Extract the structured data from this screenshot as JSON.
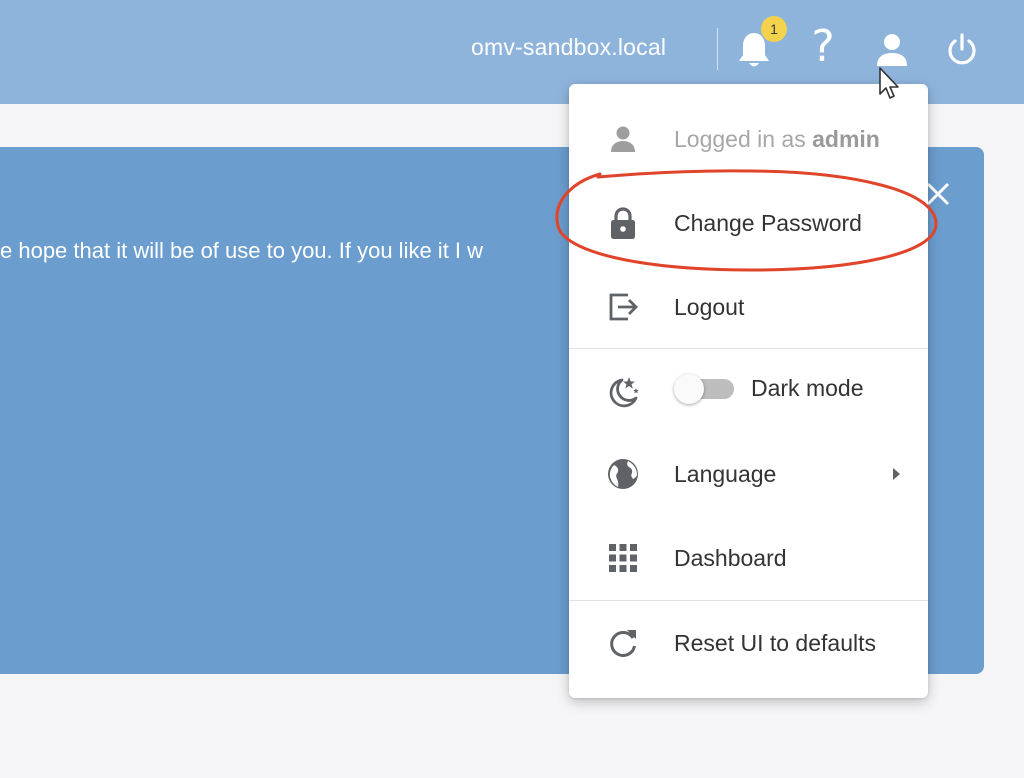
{
  "header": {
    "hostname": "omv-sandbox.local",
    "notifications_count": "1",
    "help_glyph": "?",
    "icons": [
      "bell-icon",
      "help-icon",
      "user-icon",
      "power-icon"
    ]
  },
  "welcome": {
    "text": "e hope that it will be of use to you. If you like it I w",
    "close_icon": "close-icon"
  },
  "user_menu": {
    "logged_in_prefix": "Logged in as ",
    "username": "admin",
    "items": [
      {
        "label": "Change Password",
        "icon": "lock-icon"
      },
      {
        "label": "Logout",
        "icon": "logout-icon"
      },
      {
        "label": "Dark mode",
        "icon": "moon-stars-icon",
        "toggle_on": false
      },
      {
        "label": "Language",
        "icon": "globe-icon"
      },
      {
        "label": "Dashboard",
        "icon": "grid-icon"
      },
      {
        "label": "Reset UI to defaults",
        "icon": "refresh-icon"
      }
    ]
  },
  "colors": {
    "topbar": "#8fb4dc",
    "welcome_panel": "#6b9dcf",
    "badge": "#f3d24c",
    "annotation": "#e0442a",
    "menu_icon": "#5f6368"
  }
}
